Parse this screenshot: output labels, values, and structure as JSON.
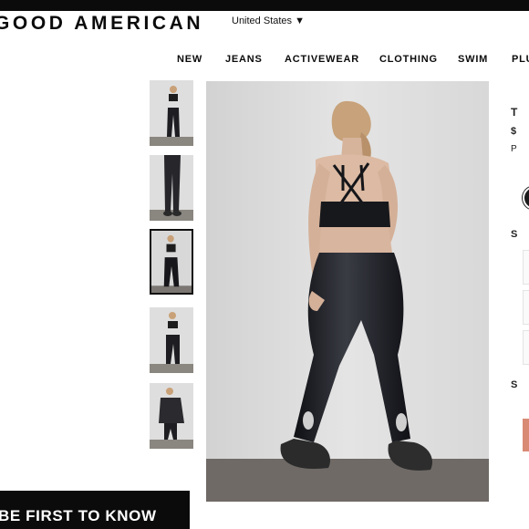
{
  "header": {
    "brand": "GOOD AMERICAN",
    "country": "United States ▼"
  },
  "nav": {
    "items": [
      {
        "label": "NEW"
      },
      {
        "label": "JEANS"
      },
      {
        "label": "ACTIVEWEAR"
      },
      {
        "label": "CLOTHING"
      },
      {
        "label": "SWIM"
      },
      {
        "label": "PLUS"
      }
    ]
  },
  "gallery": {
    "thumbnail_count": 5,
    "selected_index": 2
  },
  "product_panel": {
    "title_initial": "T",
    "price_initial": "$",
    "note_initial": "P",
    "size_initial": "S",
    "size2_initial": "S"
  },
  "signup_banner": {
    "text": "BE FIRST TO KNOW"
  },
  "colors": {
    "topbar": "#0b0b0b",
    "photo_background": "#dcdcdc",
    "leggings": "#16171c",
    "add_to_bag": "#d98a75"
  }
}
